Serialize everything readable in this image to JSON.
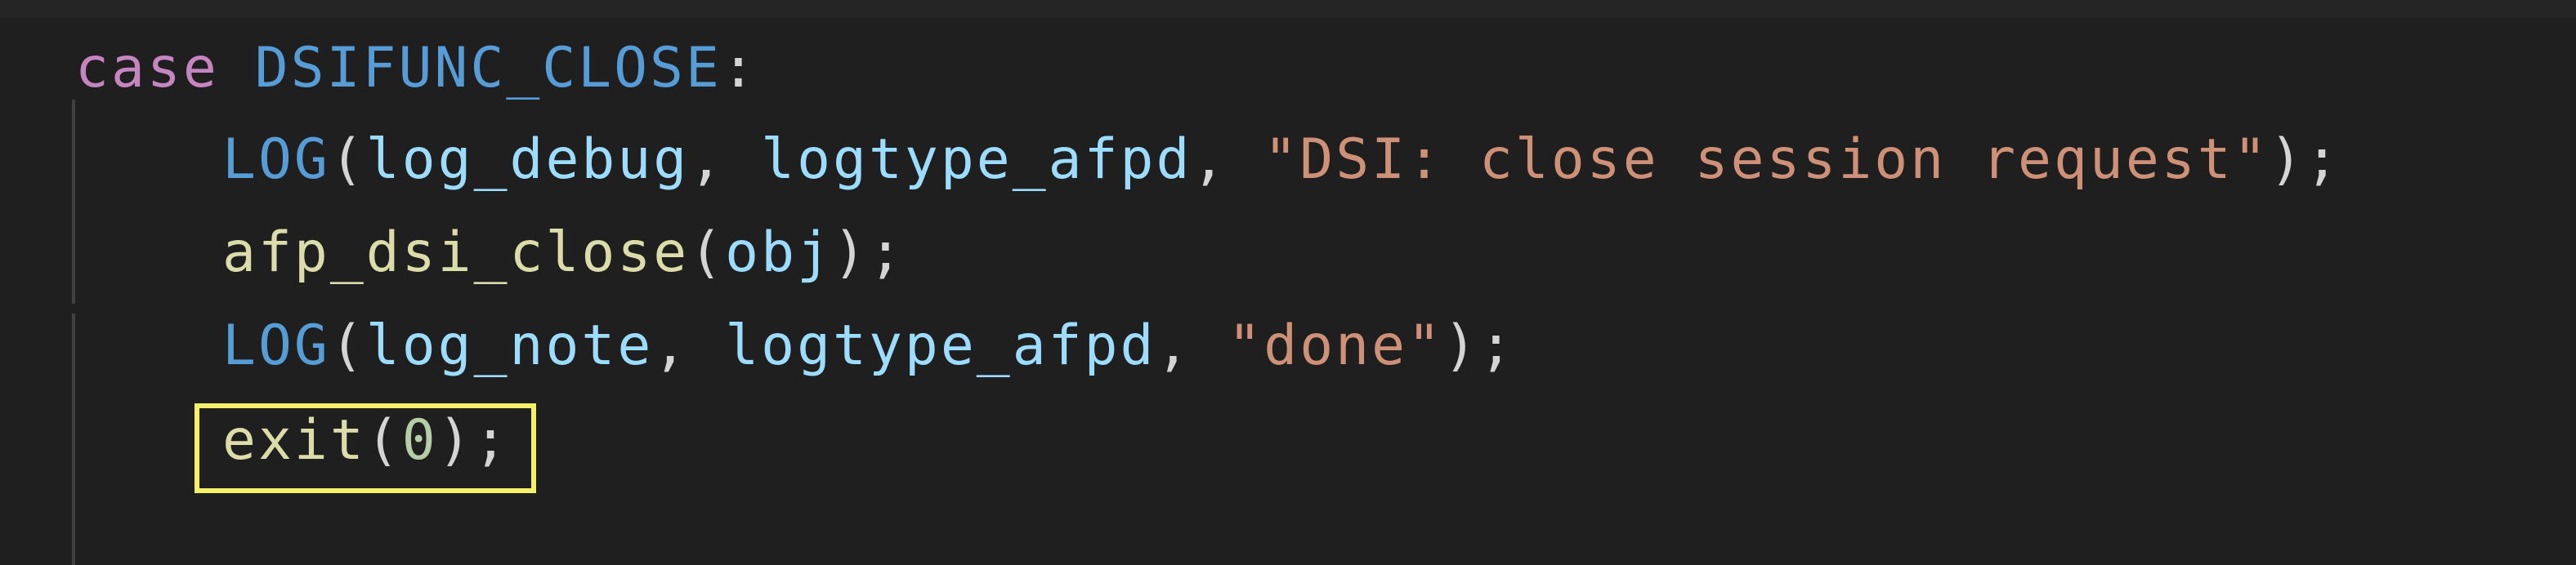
{
  "code": {
    "line1": {
      "keyword": "case",
      "constant": "DSIFUNC_CLOSE",
      "colon": ":"
    },
    "line2": {
      "macro": "LOG",
      "open": "(",
      "arg1": "log_debug",
      "comma1": ", ",
      "arg2": "logtype_afpd",
      "comma2": ", ",
      "string": "\"DSI: close session request\"",
      "close": ");"
    },
    "line3": {
      "function": "afp_dsi_close",
      "open": "(",
      "arg": "obj",
      "close": ");"
    },
    "line4": {
      "macro": "LOG",
      "open": "(",
      "arg1": "log_note",
      "comma1": ", ",
      "arg2": "logtype_afpd",
      "comma2": ", ",
      "string": "\"done\"",
      "close": ");"
    },
    "line5": {
      "function": "exit",
      "open": "(",
      "number": "0",
      "close": ");"
    }
  },
  "colors": {
    "background": "#1f1f1f",
    "keyword": "#c586c0",
    "constant": "#569cd6",
    "variable": "#9cdcfe",
    "function": "#dcdcaa",
    "string": "#ce9178",
    "number": "#b5cea8",
    "highlight_border": "#f4f06a"
  }
}
